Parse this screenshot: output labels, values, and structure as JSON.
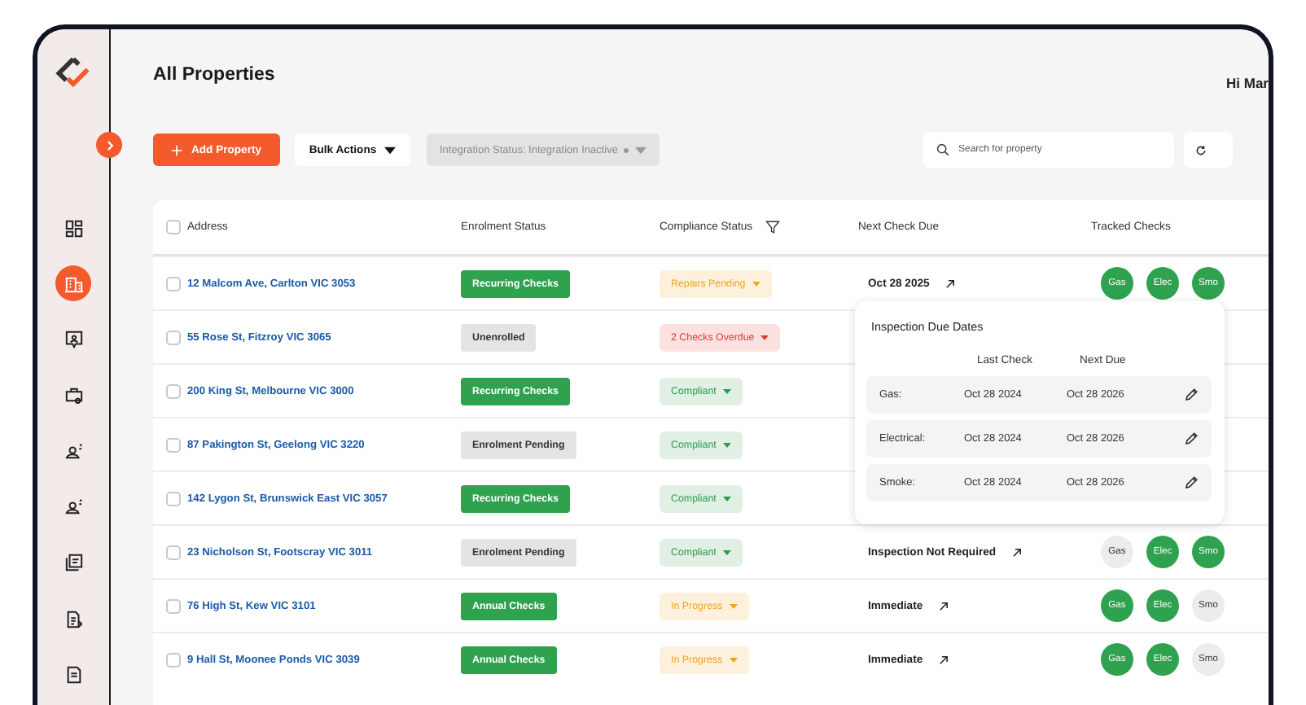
{
  "greeting": "Hi Mar",
  "sidebar": {
    "items": [
      {
        "selected": false
      },
      {
        "selected": true
      },
      {
        "selected": false
      },
      {
        "selected": false
      },
      {
        "selected": false
      },
      {
        "selected": false
      },
      {
        "selected": false
      },
      {
        "selected": false
      },
      {
        "selected": false
      }
    ]
  },
  "page_title": "All Properties",
  "toolbar": {
    "add_button": "Add Property",
    "bulk_actions": "Bulk Actions",
    "integration_filter": {
      "label": "Integration Status: Integration Inactive",
      "disabled": true
    },
    "search": {
      "placeholder": "Search for property"
    }
  },
  "table": {
    "select_all_checked": false,
    "columns": [
      {
        "label": "Address",
        "filter": false
      },
      {
        "label": "Enrolment Status",
        "filter": false
      },
      {
        "label": "Compliance Status",
        "filter": true
      },
      {
        "label": "Next Check Due",
        "filter": false
      },
      {
        "label": "Tracked Checks",
        "filter": false
      }
    ],
    "rows": [
      {
        "checked": false,
        "address": "12 Malcom Ave, Carlton VIC 3053",
        "enrolment": {
          "label": "Recurring Checks",
          "color": "#2ea24e"
        },
        "compliance": {
          "label": "Repairs Pending",
          "color": "#f2a41f"
        },
        "next_check": "Oct 28 2025",
        "tracked": [
          {
            "label": "Gas",
            "color": "#2ea24e"
          },
          {
            "label": "Elec",
            "color": "#2ea24e"
          },
          {
            "label": "Smo",
            "color": "#2ea24e"
          }
        ]
      },
      {
        "checked": false,
        "address": "55 Rose St, Fitzroy VIC 3065",
        "enrolment": {
          "label": "Unenrolled",
          "color": "#e4e4e4"
        },
        "compliance": {
          "label": "2 Checks Overdue",
          "color": "#e23a33"
        }
      },
      {
        "checked": false,
        "address": "200 King St, Melbourne VIC 3000",
        "enrolment": {
          "label": "Recurring Checks",
          "color": "#2ea24e"
        },
        "compliance": {
          "label": "Compliant",
          "color": "#2c9a4c"
        }
      },
      {
        "checked": false,
        "address": "87 Pakington St, Geelong VIC 3220",
        "enrolment": {
          "label": "Enrolment Pending",
          "color": "#e4e4e4"
        },
        "compliance": {
          "label": "Compliant",
          "color": "#2c9a4c"
        }
      },
      {
        "checked": false,
        "address": "142 Lygon St, Brunswick East VIC 3057",
        "enrolment": {
          "label": "Recurring Checks",
          "color": "#2ea24e"
        },
        "compliance": {
          "label": "Compliant",
          "color": "#2c9a4c"
        }
      },
      {
        "checked": false,
        "address": "23 Nicholson St, Footscray VIC 3011",
        "enrolment": {
          "label": "Enrolment Pending",
          "color": "#e4e4e4"
        },
        "compliance": {
          "label": "Compliant",
          "color": "#2c9a4c"
        },
        "next_check": "Inspection Not Required",
        "tracked": [
          {
            "label": "Gas",
            "color": "#ececec"
          },
          {
            "label": "Elec",
            "color": "#2ea24e"
          },
          {
            "label": "Smo",
            "color": "#2ea24e"
          }
        ]
      },
      {
        "checked": false,
        "address": "76 High St, Kew VIC 3101",
        "enrolment": {
          "label": "Annual Checks",
          "color": "#2ea24e"
        },
        "compliance": {
          "label": "In Progress",
          "color": "#f2a41f"
        },
        "next_check": "Immediate",
        "tracked": [
          {
            "label": "Gas",
            "color": "#2ea24e"
          },
          {
            "label": "Elec",
            "color": "#2ea24e"
          },
          {
            "label": "Smo",
            "color": "#ececec"
          }
        ]
      },
      {
        "checked": false,
        "address": "9 Hall St, Moonee Ponds VIC 3039",
        "enrolment": {
          "label": "Annual Checks",
          "color": "#2ea24e"
        },
        "compliance": {
          "label": "In Progress",
          "color": "#f2a41f"
        },
        "next_check": "Immediate",
        "tracked": [
          {
            "label": "Gas",
            "color": "#2ea24e"
          },
          {
            "label": "Elec",
            "color": "#2ea24e"
          },
          {
            "label": "Smo",
            "color": "#ececec"
          }
        ]
      }
    ]
  },
  "popover": {
    "title": "Inspection Due Dates",
    "columns": [
      "Last Check",
      "Next Due"
    ],
    "rows": [
      {
        "label": "Gas:",
        "last": "Oct 28 2024",
        "next": "Oct 28 2026"
      },
      {
        "label": "Electrical:",
        "last": "Oct 28 2024",
        "next": "Oct 28 2026"
      },
      {
        "label": "Smoke:",
        "last": "Oct 28 2024",
        "next": "Oct 28 2026"
      }
    ]
  }
}
